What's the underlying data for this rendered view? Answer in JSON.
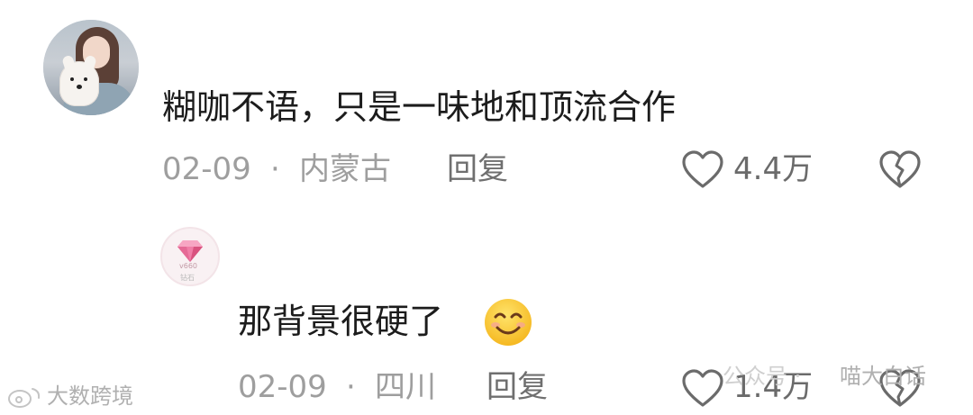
{
  "comments": [
    {
      "text": "糊咖不语，只是一味地和顶流合作",
      "date": "02-09",
      "separator": "·",
      "location": "内蒙古",
      "reply_label": "回复",
      "like_count": "4.4万"
    },
    {
      "text": "那背景很硬了",
      "emoji": "😊",
      "date": "02-09",
      "separator": "·",
      "location": "四川",
      "reply_label": "回复",
      "like_count": "1.4万"
    }
  ],
  "badge": {
    "level": "v660",
    "label": "钻石"
  },
  "watermarks": {
    "left": "大数跨境",
    "right_prefix": "公众号 ·",
    "right_name": "喵大白话"
  },
  "colors": {
    "text": "#1c1c1c",
    "meta": "#9e9e9e",
    "icon": "#6b6b6b",
    "badge_pink": "#e56a96"
  },
  "icons": [
    "avatar",
    "heart-outline-icon",
    "broken-heart-icon",
    "diamond-badge-icon",
    "emoji-smile-icon",
    "weibo-logo-icon"
  ]
}
